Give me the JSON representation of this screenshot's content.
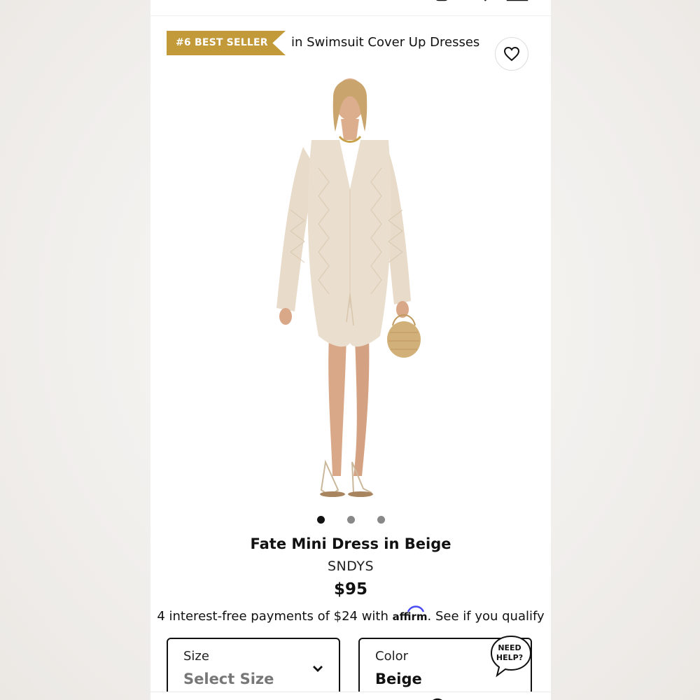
{
  "badge": {
    "label": "#6 BEST SELLER"
  },
  "category": {
    "text": "in Swimsuit Cover Up Dresses"
  },
  "wishlist": {
    "icon": "heart-icon"
  },
  "gallery": {
    "image_count": 3,
    "active_index": 0
  },
  "product": {
    "title": "Fate Mini Dress in Beige",
    "brand": "SNDYS",
    "price": "$95"
  },
  "financing": {
    "prefix": "4 interest-free payments of $24 with ",
    "provider": "affirm",
    "suffix": ". See if you qualify"
  },
  "size": {
    "label": "Size",
    "value": "Select Size"
  },
  "color": {
    "label": "Color",
    "value": "Beige"
  },
  "help": {
    "line1": "NEED",
    "line2": "HELP?"
  },
  "colors": {
    "badge": "#c39a3a",
    "affirm_arc": "#4a4af4"
  }
}
